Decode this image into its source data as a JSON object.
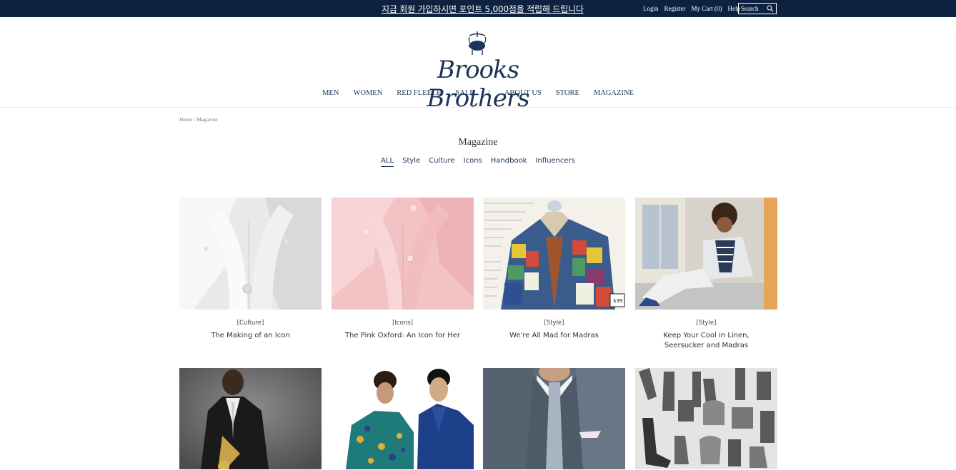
{
  "promo": {
    "text": "지금 회원 가입하시면 포인트 5,000점을 적립해 드립니다"
  },
  "utility": {
    "login": "Login",
    "register": "Register",
    "cart": "My Cart (0)",
    "help": "Help",
    "search_label": "Search"
  },
  "brand": {
    "logo_text": "Brooks Brothers",
    "color": "#1c3457"
  },
  "nav": {
    "items": [
      "MEN",
      "WOMEN",
      "RED FLEECE",
      "SALE"
    ],
    "separator": "|",
    "items2": [
      "ABOUT US",
      "STORE",
      "MAGAZINE"
    ]
  },
  "breadcrumb": {
    "home": "Home",
    "sep": " / ",
    "current": "Magazine"
  },
  "page": {
    "title": "Magazine"
  },
  "tabs": [
    "ALL",
    "Style",
    "Culture",
    "Icons",
    "Handbook",
    "Influencers"
  ],
  "articles": [
    {
      "category": "[Culture]",
      "title": "The Making of an Icon"
    },
    {
      "category": "[Icons]",
      "title": "The Pink Oxford: An Icon for Her"
    },
    {
      "category": "[Style]",
      "title": "We're All Mad for Madras"
    },
    {
      "category": "[Style]",
      "title": "Keep Your Cool in Linen, Seersucker and Madras"
    },
    {
      "category": "",
      "title": ""
    },
    {
      "category": "",
      "title": ""
    },
    {
      "category": "",
      "title": ""
    },
    {
      "category": "",
      "title": ""
    }
  ],
  "madras_text": "Cool, lightweight and unusually -looking ... our sp ster and linen blend ely for us in ts are tai , yellow Polyes the sa Eve Our ghtwe otton",
  "price_tag": "$39"
}
